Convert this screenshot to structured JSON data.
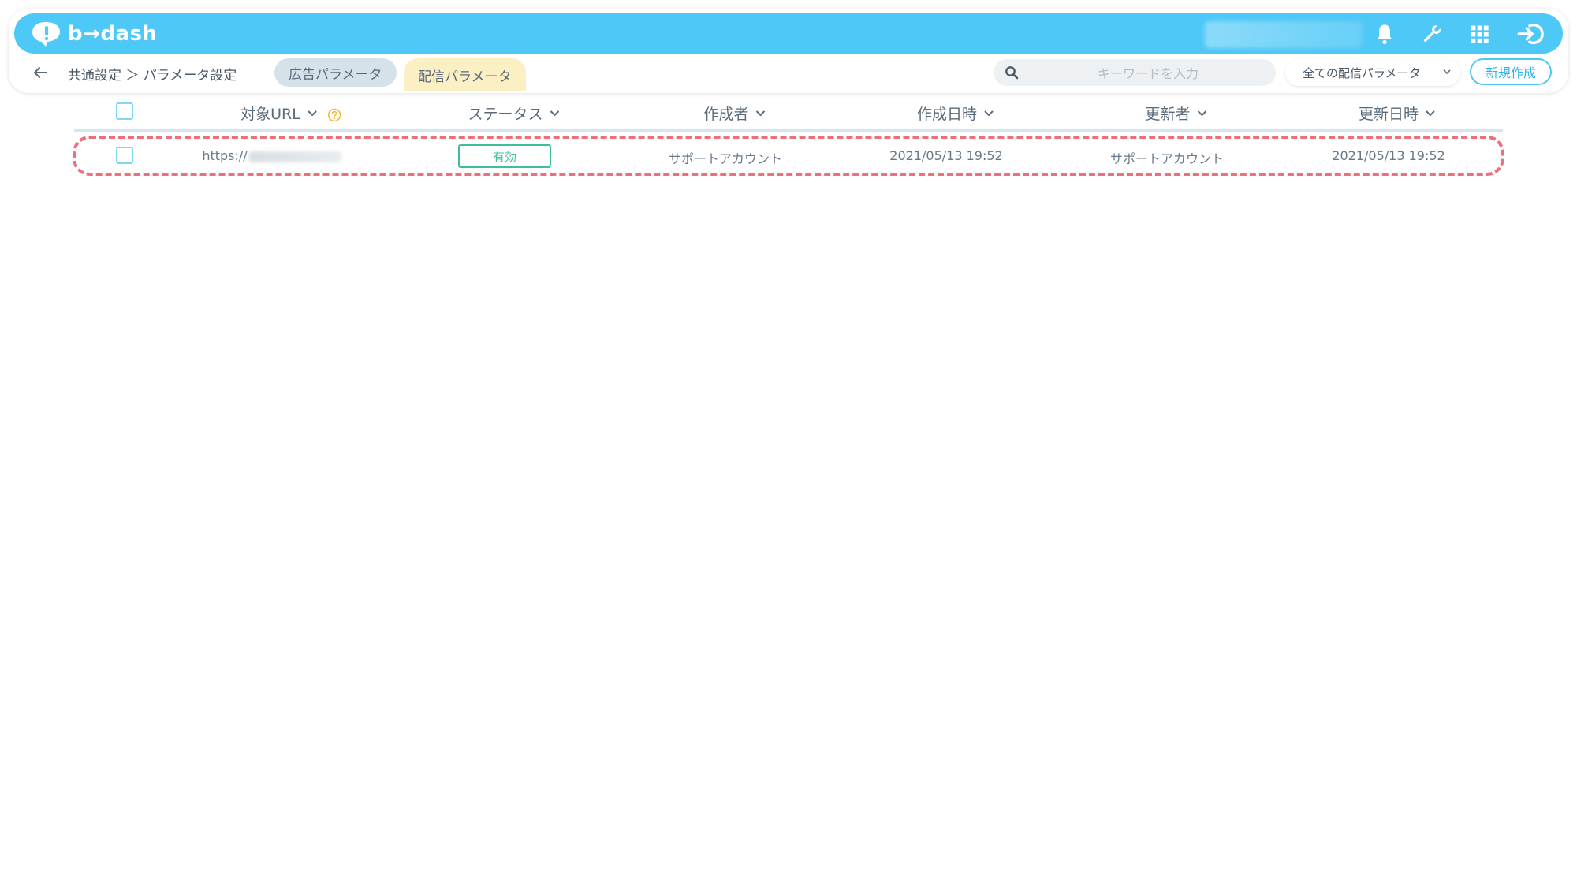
{
  "app": {
    "logo_text": "b→dash",
    "brand_color": "#4ec8f7",
    "icons": [
      "bell-icon",
      "wrench-icon",
      "apps-grid-icon",
      "logout-icon"
    ]
  },
  "nav": {
    "breadcrumb": "共通設定 ＞ パラメータ設定",
    "tabs": [
      {
        "label": "広告パラメータ",
        "active": false
      },
      {
        "label": "配信パラメータ",
        "active": true
      }
    ],
    "search_placeholder": "キーワードを入力",
    "filter_value": "全ての配信パラメータ",
    "new_button": "新規作成"
  },
  "table": {
    "columns": [
      "対象URL",
      "ステータス",
      "作成者",
      "作成日時",
      "更新者",
      "更新日時"
    ],
    "rows": [
      {
        "url": "https://",
        "status": "有効",
        "creator": "サポートアカウント",
        "created_at": "2021/05/13 19:52",
        "updater": "サポートアカウント",
        "updated_at": "2021/05/13 19:52"
      }
    ]
  },
  "colors": {
    "status_active": "#3dbf9b",
    "highlight_outline": "#ee6f7c",
    "help_icon": "#f5b731"
  }
}
